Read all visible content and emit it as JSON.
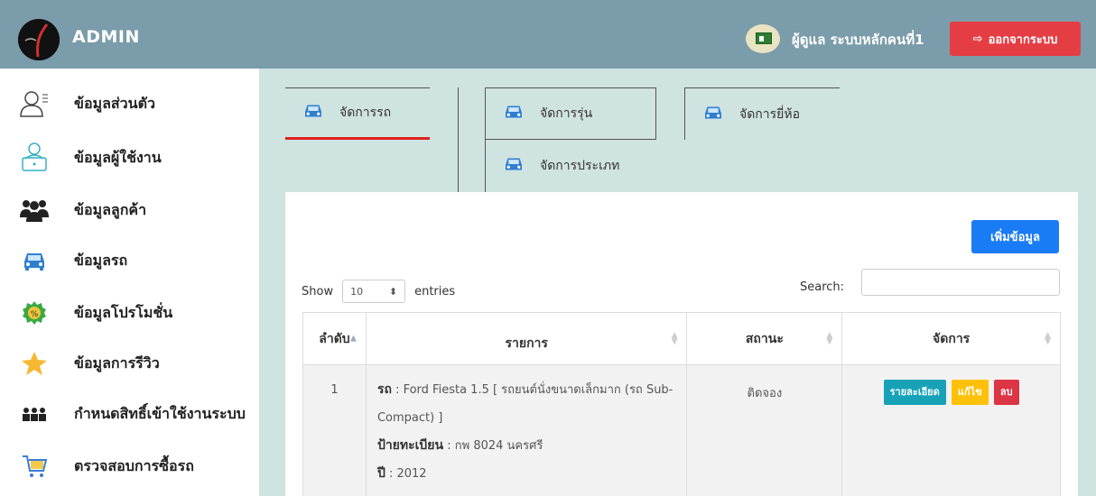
{
  "header": {
    "brand": "ADMIN",
    "user_name": "ผู้ดูแล ระบบหลักคนที่1",
    "logout_label": "ออกจากระบบ"
  },
  "sidebar": {
    "items": [
      {
        "label": "ข้อมูลส่วนตัว",
        "icon": "user-profile-icon"
      },
      {
        "label": "ข้อมูลผู้ใช้งาน",
        "icon": "user-laptop-icon"
      },
      {
        "label": "ข้อมูลลูกค้า",
        "icon": "users-group-icon"
      },
      {
        "label": "ข้อมูลรถ",
        "icon": "car-icon"
      },
      {
        "label": "ข้อมูลโปรโมชั่น",
        "icon": "promotion-badge-icon"
      },
      {
        "label": "ข้อมูลการรีวิว",
        "icon": "star-icon"
      },
      {
        "label": "กำหนดสิทธิ์เข้าใช้งานระบบ",
        "icon": "permissions-icon"
      },
      {
        "label": "ตรวจสอบการซื้อรถ",
        "icon": "cart-icon"
      }
    ]
  },
  "tabs": [
    {
      "label": "จัดการรถ"
    },
    {
      "label": "จัดการรุ่น"
    },
    {
      "label": "จัดการยี่ห้อ"
    },
    {
      "label": "จัดการประเภท"
    }
  ],
  "panel": {
    "add_label": "เพิ่มข้อมูล",
    "show_label": "Show",
    "entries_value": "10",
    "entries_label": "entries",
    "search_label": "Search:",
    "search_value": ""
  },
  "table": {
    "headers": [
      "ลำดับ",
      "รายการ",
      "สถานะ",
      "จัดการ"
    ],
    "rows": [
      {
        "index": "1",
        "car_key": "รถ",
        "car_value": ": Ford Fiesta 1.5 [ รถยนต์นั่งขนาดเล็กมาก (รถ Sub-Compact) ]",
        "plate_key": "ป้ายทะเบียน",
        "plate_value": ": กพ 8024 นครศรี",
        "year_key": "ปี",
        "year_value": ": 2012",
        "status": "ติดจอง",
        "btn_detail": "รายละเอียด",
        "btn_edit": "แก้ไข",
        "btn_delete": "ลบ"
      }
    ]
  },
  "colors": {
    "header_bg": "#7b9caa",
    "logout_bg": "#e53d44",
    "add_bg": "#1a7cf5",
    "active_tab_underline": "#e02020"
  }
}
